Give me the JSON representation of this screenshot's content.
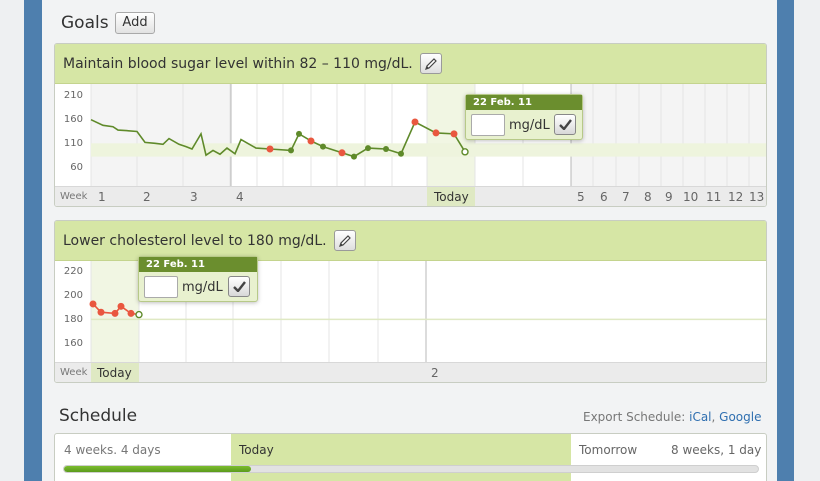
{
  "goals": {
    "title": "Goals",
    "add_label": "Add"
  },
  "goal1": {
    "title": "Maintain blood sugar level within 82 – 110 mg/dL.",
    "yticks": [
      "210",
      "160",
      "110",
      "60"
    ],
    "week_label": "Week",
    "weeks_left": [
      "1",
      "2",
      "3",
      "4"
    ],
    "today_label": "Today",
    "weeks_right": [
      "5",
      "6",
      "7",
      "8",
      "9",
      "10",
      "11",
      "12",
      "13"
    ],
    "tooltip": {
      "date": "22 Feb. 11",
      "unit": "mg/dL",
      "value": ""
    },
    "colors": {
      "line": "#5f8a2a",
      "highlight": "#e9573f",
      "band": "#eef4dd"
    }
  },
  "goal2": {
    "title": "Lower cholesterol level to 180 mg/dL.",
    "yticks": [
      "220",
      "200",
      "180",
      "160"
    ],
    "week_label": "Week",
    "today_label": "Today",
    "week_next": "2",
    "tooltip": {
      "date": "22 Feb. 11",
      "unit": "mg/dL",
      "value": ""
    }
  },
  "schedule": {
    "title": "Schedule",
    "export_label": "Export Schedule:",
    "ical": "iCal",
    "google": "Google",
    "past": "4 weeks. 4 days",
    "today": "Today",
    "tomorrow": "Tomorrow",
    "remaining": "8 weeks, 1 day",
    "progress": 0.27
  },
  "chart_data": [
    {
      "type": "line",
      "ylim": [
        60,
        210
      ],
      "yticks": [
        210,
        160,
        110,
        60
      ],
      "target_band": [
        82,
        110
      ],
      "values": [
        160,
        148,
        145,
        138,
        137,
        135,
        112,
        110,
        108,
        120,
        108,
        103,
        98,
        130,
        85,
        95,
        87,
        100,
        88,
        118,
        100,
        98,
        95,
        130,
        115,
        103,
        90,
        82,
        100,
        98,
        88,
        155,
        132,
        130,
        92
      ]
    },
    {
      "type": "line",
      "ylim": [
        160,
        220
      ],
      "yticks": [
        220,
        200,
        180,
        160
      ],
      "target": 180,
      "values": [
        193,
        186,
        185,
        191,
        185,
        184
      ]
    }
  ]
}
